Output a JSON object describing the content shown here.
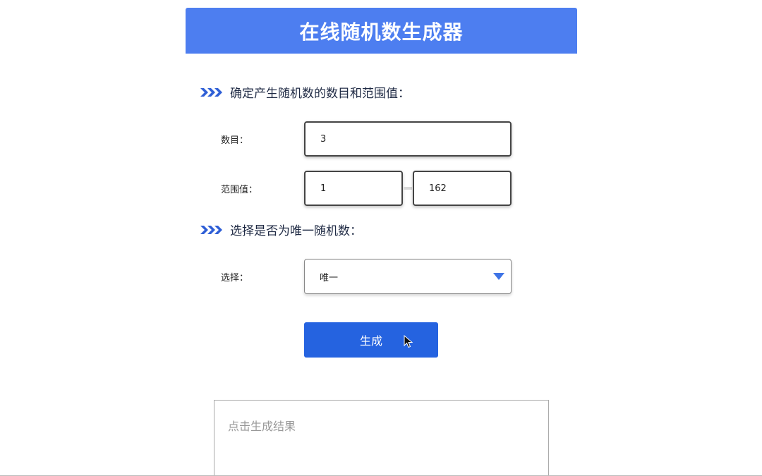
{
  "header": {
    "title": "在线随机数生成器"
  },
  "section1": {
    "title": "确定产生随机数的数目和范围值："
  },
  "count_field": {
    "label": "数目：",
    "value": "3"
  },
  "range_field": {
    "label": "范围值：",
    "min_value": "1",
    "max_value": "162"
  },
  "section2": {
    "title": "选择是否为唯一随机数："
  },
  "unique_select": {
    "label": "选择：",
    "selected": "唯一"
  },
  "generate_button": {
    "label": "生成"
  },
  "result": {
    "placeholder": "点击生成结果"
  },
  "colors": {
    "header": "#4d7ef0",
    "button": "#2563e0",
    "arrow": "#3f74e6"
  },
  "icons": [
    "chevrons-right-icon",
    "chevron-down-icon",
    "mouse-cursor-icon"
  ]
}
